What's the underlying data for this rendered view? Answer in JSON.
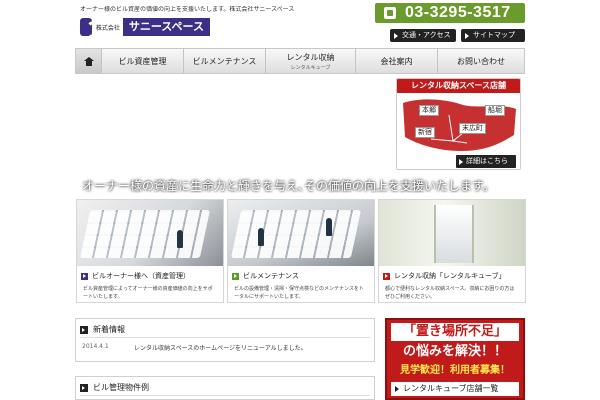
{
  "header": {
    "tagline": "オーナー様のビル資産の価値の向上を支援いたします。株式会社サニースペース",
    "logo_company": "株式会社",
    "logo_name": "サニースペース",
    "phone": "03-3295-3517",
    "links": {
      "access": "交通・アクセス",
      "sitemap": "サイトマップ"
    }
  },
  "nav": {
    "home_icon": "home-icon",
    "items": [
      {
        "label": "ビル資産管理"
      },
      {
        "label": "ビルメンテナンス"
      },
      {
        "label": "レンタル収納",
        "sub": "レンタルキューブ"
      },
      {
        "label": "会社案内"
      },
      {
        "label": "お問い合わせ"
      }
    ]
  },
  "hero": {
    "copy": "オーナー様の資産に生命力と輝きを与え､その価値の向上を支援いたします。",
    "map": {
      "title": "レンタル収納スペース店舗",
      "labels": [
        "本郷",
        "船堀",
        "新宿",
        "末広町"
      ],
      "detail": "詳細はこちら"
    }
  },
  "cards": [
    {
      "title": "ビルオーナー様へ（資産管理）",
      "desc": "ビル資産管理によってオーナー様の資産価値の向上をサポートいたします。"
    },
    {
      "title": "ビルメンテナンス",
      "desc": "ビルの設備管理・清掃・保守点検などのメンテナンスをトータルにサポートいたします。"
    },
    {
      "title": "レンタル収納「レンタルキューブ」",
      "desc": "都心で便利なレンタル収納スペース。収納にお困りの方はぜひご利用ください。"
    }
  ],
  "news": {
    "title": "新着情報",
    "items": [
      {
        "date": "2014.4.1",
        "text": "レンタル収納スペースのホームページをリニューアルしました。"
      }
    ]
  },
  "examples": {
    "title": "ビル管理物件例"
  },
  "banner": {
    "line1": "「置き場所不足」",
    "line2": "の悩みを解決！！",
    "line3": "見学歓迎！利用者募集！",
    "stores": "レンタルキューブ店舗一覧"
  },
  "colors": {
    "brand": "#3e2f86",
    "phone_bg": "#6b9a2d",
    "rental_red": "#c01a1a"
  }
}
